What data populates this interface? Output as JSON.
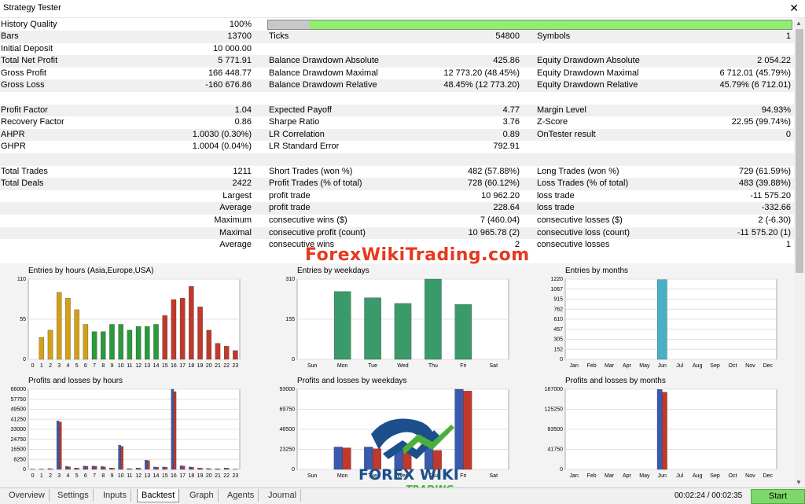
{
  "window": {
    "title": "Strategy Tester"
  },
  "history_quality": {
    "label": "History Quality",
    "value": "100%",
    "fraction": 0.92
  },
  "rows": [
    {
      "shade": true,
      "c1l": "Bars",
      "c1r": "13700",
      "c2l": "Ticks",
      "c2r": "54800",
      "c3l": "Symbols",
      "c3r": "1"
    },
    {
      "shade": false,
      "c1l": "Initial Deposit",
      "c1r": "10 000.00",
      "c2l": "",
      "c2r": "",
      "c3l": "",
      "c3r": ""
    },
    {
      "shade": true,
      "c1l": "Total Net Profit",
      "c1r": "5 771.91",
      "c2l": "Balance Drawdown Absolute",
      "c2r": "425.86",
      "c3l": "Equity Drawdown Absolute",
      "c3r": "2 054.22"
    },
    {
      "shade": false,
      "c1l": "Gross Profit",
      "c1r": "166 448.77",
      "c2l": "Balance Drawdown Maximal",
      "c2r": "12 773.20 (48.45%)",
      "c3l": "Equity Drawdown Maximal",
      "c3r": "6 712.01 (45.79%)"
    },
    {
      "shade": true,
      "c1l": "Gross Loss",
      "c1r": "-160 676.86",
      "c2l": "Balance Drawdown Relative",
      "c2r": "48.45% (12 773.20)",
      "c3l": "Equity Drawdown Relative",
      "c3r": "45.79% (6 712.01)"
    },
    {
      "shade": false,
      "c1l": "",
      "c1r": "",
      "c2l": "",
      "c2r": "",
      "c3l": "",
      "c3r": ""
    },
    {
      "shade": true,
      "c1l": "Profit Factor",
      "c1r": "1.04",
      "c2l": "Expected Payoff",
      "c2r": "4.77",
      "c3l": "Margin Level",
      "c3r": "94.93%"
    },
    {
      "shade": false,
      "c1l": "Recovery Factor",
      "c1r": "0.86",
      "c2l": "Sharpe Ratio",
      "c2r": "3.76",
      "c3l": "Z-Score",
      "c3r": "22.95 (99.74%)"
    },
    {
      "shade": true,
      "c1l": "AHPR",
      "c1r": "1.0030 (0.30%)",
      "c2l": "LR Correlation",
      "c2r": "0.89",
      "c3l": "OnTester result",
      "c3r": "0"
    },
    {
      "shade": false,
      "c1l": "GHPR",
      "c1r": "1.0004 (0.04%)",
      "c2l": "LR Standard Error",
      "c2r": "792.91",
      "c3l": "",
      "c3r": ""
    },
    {
      "shade": true,
      "c1l": "",
      "c1r": "",
      "c2l": "",
      "c2r": "",
      "c3l": "",
      "c3r": ""
    },
    {
      "shade": false,
      "c1l": "Total Trades",
      "c1r": "1211",
      "c2l": "Short Trades (won %)",
      "c2r": "482 (57.88%)",
      "c3l": "Long Trades (won %)",
      "c3r": "729 (61.59%)"
    },
    {
      "shade": true,
      "c1l": "Total Deals",
      "c1r": "2422",
      "c2l": "Profit Trades (% of total)",
      "c2r": "728 (60.12%)",
      "c3l": "Loss Trades (% of total)",
      "c3r": "483 (39.88%)"
    },
    {
      "shade": false,
      "c1l": "",
      "c1r": "Largest",
      "c2l": "profit trade",
      "c2r": "10 962.20",
      "c3l": "loss trade",
      "c3r": "-11 575.20"
    },
    {
      "shade": true,
      "c1l": "",
      "c1r": "Average",
      "c2l": "profit trade",
      "c2r": "228.64",
      "c3l": "loss trade",
      "c3r": "-332.66"
    },
    {
      "shade": false,
      "c1l": "",
      "c1r": "Maximum",
      "c2l": "consecutive wins ($)",
      "c2r": "7 (460.04)",
      "c3l": "consecutive losses ($)",
      "c3r": "2 (-6.30)"
    },
    {
      "shade": true,
      "c1l": "",
      "c1r": "Maximal",
      "c2l": "consecutive profit (count)",
      "c2r": "10 965.78 (2)",
      "c3l": "consecutive loss (count)",
      "c3r": "-11 575.20 (1)"
    },
    {
      "shade": false,
      "c1l": "",
      "c1r": "Average",
      "c2l": "consecutive wins",
      "c2r": "2",
      "c3l": "consecutive losses",
      "c3r": "1"
    }
  ],
  "watermark": {
    "text": "ForexWikiTrading.com",
    "logo_text_1": "FOREX WIKI",
    "logo_text_2": "TRADING"
  },
  "chart_data": [
    {
      "type": "bar",
      "title": "Entries by hours (Asia,Europe,USA)",
      "categories": [
        "0",
        "1",
        "2",
        "3",
        "4",
        "5",
        "6",
        "7",
        "8",
        "9",
        "10",
        "11",
        "12",
        "13",
        "14",
        "15",
        "16",
        "17",
        "18",
        "19",
        "20",
        "21",
        "22",
        "23"
      ],
      "values": [
        0,
        30,
        40,
        92,
        84,
        68,
        48,
        38,
        38,
        48,
        48,
        40,
        45,
        45,
        48,
        60,
        82,
        84,
        100,
        72,
        40,
        22,
        18,
        12
      ],
      "colors": [
        "#d4a017",
        "#d4a017",
        "#d4a017",
        "#d4a017",
        "#d4a017",
        "#d4a017",
        "#d4a017",
        "#2a9a3a",
        "#2a9a3a",
        "#2a9a3a",
        "#2a9a3a",
        "#2a9a3a",
        "#2a9a3a",
        "#2a9a3a",
        "#2a9a3a",
        "#c0392b",
        "#c0392b",
        "#c0392b",
        "#c0392b",
        "#c0392b",
        "#c0392b",
        "#c0392b",
        "#c0392b",
        "#c0392b"
      ],
      "yticks": [
        "0",
        "55",
        "110"
      ],
      "ymax": 110
    },
    {
      "type": "bar",
      "title": "Entries by weekdays",
      "categories": [
        "Sun",
        "Mon",
        "Tue",
        "Wed",
        "Thu",
        "Fri",
        "Sat"
      ],
      "values": [
        0,
        262,
        238,
        216,
        310,
        212,
        0
      ],
      "colors": [
        "#3a9a6a",
        "#3a9a6a",
        "#3a9a6a",
        "#3a9a6a",
        "#3a9a6a",
        "#3a9a6a",
        "#3a9a6a"
      ],
      "yticks": [
        "0",
        "155",
        "310"
      ],
      "ymax": 310
    },
    {
      "type": "bar",
      "title": "Entries by months",
      "categories": [
        "Jan",
        "Feb",
        "Mar",
        "Apr",
        "May",
        "Jun",
        "Jul",
        "Aug",
        "Sep",
        "Oct",
        "Nov",
        "Dec"
      ],
      "values": [
        0,
        0,
        0,
        0,
        0,
        1211,
        0,
        0,
        0,
        0,
        0,
        0
      ],
      "colors": [
        "#4ab0c8",
        "#4ab0c8",
        "#4ab0c8",
        "#4ab0c8",
        "#4ab0c8",
        "#4ab0c8",
        "#4ab0c8",
        "#4ab0c8",
        "#4ab0c8",
        "#4ab0c8",
        "#4ab0c8",
        "#4ab0c8"
      ],
      "yticks": [
        "0",
        "152",
        "305",
        "457",
        "610",
        "762",
        "915",
        "1067",
        "1220"
      ],
      "ymax": 1220
    },
    {
      "type": "bar",
      "title": "Profits and losses by hours",
      "categories": [
        "0",
        "1",
        "2",
        "3",
        "4",
        "5",
        "6",
        "7",
        "8",
        "9",
        "10",
        "11",
        "12",
        "13",
        "14",
        "15",
        "16",
        "17",
        "18",
        "19",
        "20",
        "21",
        "22",
        "23"
      ],
      "series": [
        {
          "color": "#3a5ab0",
          "values": [
            300,
            300,
            700,
            40000,
            2500,
            1200,
            2800,
            2800,
            2400,
            1200,
            20000,
            700,
            1200,
            7600,
            2000,
            2000,
            66000,
            3000,
            2000,
            1200,
            800,
            600,
            1200,
            200
          ]
        },
        {
          "color": "#c0392b",
          "values": [
            200,
            200,
            400,
            39000,
            2200,
            1000,
            2600,
            2600,
            2100,
            1000,
            19000,
            500,
            1000,
            7200,
            1800,
            1800,
            64000,
            2800,
            1800,
            1000,
            600,
            400,
            1000,
            100
          ]
        }
      ],
      "yticks": [
        "0",
        "8250",
        "16500",
        "24750",
        "33000",
        "41250",
        "49500",
        "57750",
        "66000"
      ],
      "ymax": 66000
    },
    {
      "type": "bar",
      "title": "Profits and losses by weekdays",
      "categories": [
        "Sun",
        "Mon",
        "Tue",
        "Wed",
        "Thu",
        "Fri",
        "Sat"
      ],
      "series": [
        {
          "color": "#3a5ab0",
          "values": [
            0,
            26000,
            26000,
            26000,
            26000,
            93000,
            0
          ]
        },
        {
          "color": "#c0392b",
          "values": [
            0,
            25000,
            24000,
            23000,
            22000,
            91000,
            0
          ]
        }
      ],
      "yticks": [
        "0",
        "23250",
        "46500",
        "69750",
        "93000"
      ],
      "ymax": 93000
    },
    {
      "type": "bar",
      "title": "Profits and losses by months",
      "categories": [
        "Jan",
        "Feb",
        "Mar",
        "Apr",
        "May",
        "Jun",
        "Jul",
        "Aug",
        "Sep",
        "Oct",
        "Nov",
        "Dec"
      ],
      "series": [
        {
          "color": "#3a5ab0",
          "values": [
            0,
            0,
            0,
            0,
            0,
            166448,
            0,
            0,
            0,
            0,
            0,
            0
          ]
        },
        {
          "color": "#c0392b",
          "values": [
            0,
            0,
            0,
            0,
            0,
            160676,
            0,
            0,
            0,
            0,
            0,
            0
          ]
        }
      ],
      "yticks": [
        "0",
        "41750",
        "83500",
        "125250",
        "167000"
      ],
      "ymax": 167000
    }
  ],
  "tabs": [
    "Overview",
    "Settings",
    "Inputs",
    "Backtest",
    "Graph",
    "Agents",
    "Journal"
  ],
  "active_tab": "Backtest",
  "status": {
    "time": "00:02:24 / 00:02:35",
    "start_label": "Start"
  }
}
